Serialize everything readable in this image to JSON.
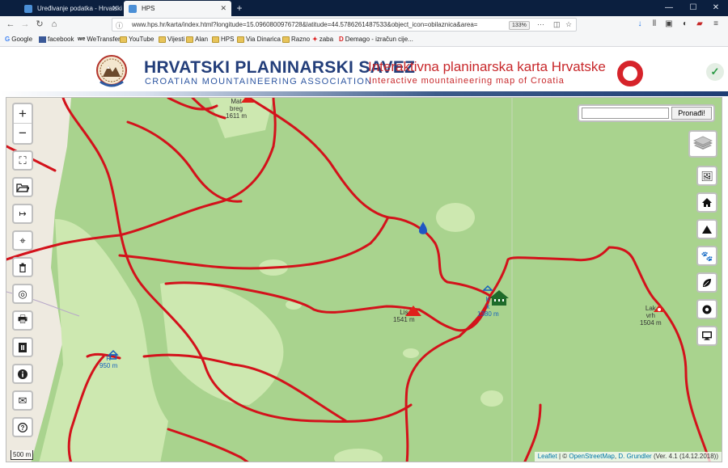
{
  "browser": {
    "tabs": [
      {
        "title": "Uređivanje podatka - Hrvatski p",
        "active": false
      },
      {
        "title": "HPS",
        "active": true
      }
    ],
    "url": "www.hps.hr/karta/index.html?longitude=15.0960800976728&latitude=44.5786261487533&object_icon=obilaznica&area=",
    "zoom": "133%",
    "bookmarks": [
      "Google",
      "facebook",
      "WeTransfer",
      "YouTube",
      "Vijesti",
      "Alan",
      "HPS",
      "Via Dinarica",
      "Razno",
      "zaba",
      "Demago - izračun cije..."
    ]
  },
  "header": {
    "org_name": "HRVATSKI PLANINARSKI SAVEZ",
    "org_name_en": "CROATIAN MOUNTAINEERING ASSOCIATION",
    "map_title": "Interaktivna planinarska karta Hrvatske",
    "map_title_en": "Interactive mountaineering map of Croatia"
  },
  "map": {
    "search_placeholder": "",
    "search_button": "Pronađi!",
    "scale": "500 m",
    "attribution": {
      "leaflet": "Leaflet",
      "sep": "| ©",
      "osm": "OpenStreetMap",
      "author": "D. Grundler",
      "version": "(Ver. 4.1 (14.12.2018))"
    },
    "labels": {
      "peak_top": [
        "Mat",
        "breg",
        "1611 m"
      ],
      "peak_center": [
        "Lis",
        "1541 m"
      ],
      "hut": [
        "K",
        "k",
        "1380 m"
      ],
      "peak_right": [
        "Lak",
        "vrh",
        "1504 m"
      ],
      "shelter_left": [
        "R",
        "950 m"
      ]
    },
    "left_controls": [
      "zoom-in",
      "zoom-out",
      "fullscreen",
      "open-file",
      "measure",
      "locate",
      "delete",
      "target",
      "print",
      "legend",
      "info",
      "email",
      "help"
    ],
    "right_controls": [
      "layers",
      "gallery",
      "huts",
      "peaks",
      "animals",
      "plants",
      "circle",
      "screen"
    ],
    "colors": {
      "trail": "#d3121b",
      "forest": "#a9d38e",
      "meadow": "#cde8b0",
      "peak": "#e0201c"
    }
  }
}
